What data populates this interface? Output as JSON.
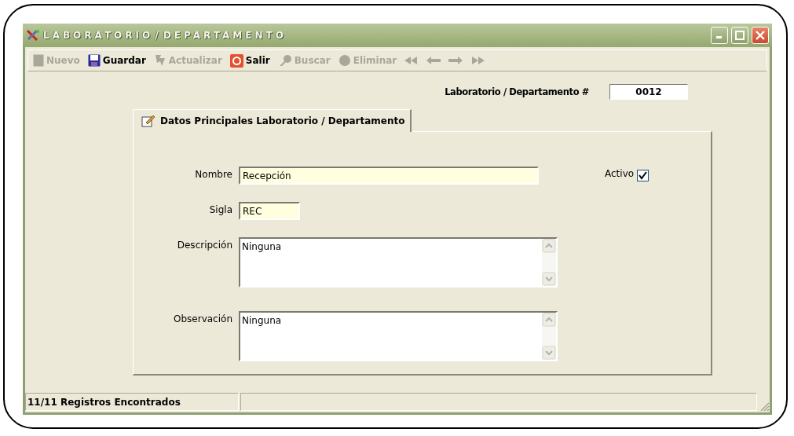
{
  "window": {
    "title": "LABORATORIO / DEPARTAMENTO"
  },
  "toolbar": [
    {
      "kind": "new",
      "label": "Nuevo",
      "disabled": true
    },
    {
      "kind": "save",
      "label": "Guardar",
      "disabled": false
    },
    {
      "kind": "refresh",
      "label": "Actualizar",
      "disabled": true
    },
    {
      "kind": "exit",
      "label": "Salir",
      "disabled": false
    },
    {
      "kind": "search",
      "label": "Buscar",
      "disabled": true
    },
    {
      "kind": "delete",
      "label": "Eliminar",
      "disabled": true
    }
  ],
  "record_number": {
    "label": "Laboratorio / Departamento #",
    "value": "0012"
  },
  "tabs": [
    {
      "label": "Datos Principales Laboratorio / Departamento",
      "selected": true
    }
  ],
  "fields": [
    {
      "kind": "wide",
      "label": "Nombre",
      "value": "Recepción"
    },
    {
      "kind": "short",
      "label": "Sigla",
      "value": "REC"
    },
    {
      "kind": "memo",
      "label": "Descripción",
      "value": "Ninguna"
    },
    {
      "kind": "memo",
      "label": "Observación",
      "value": "Ninguna"
    }
  ],
  "active": {
    "label": "Activo",
    "checked": true
  },
  "status_bar": {
    "text": "11/11 Registros Encontrados"
  }
}
